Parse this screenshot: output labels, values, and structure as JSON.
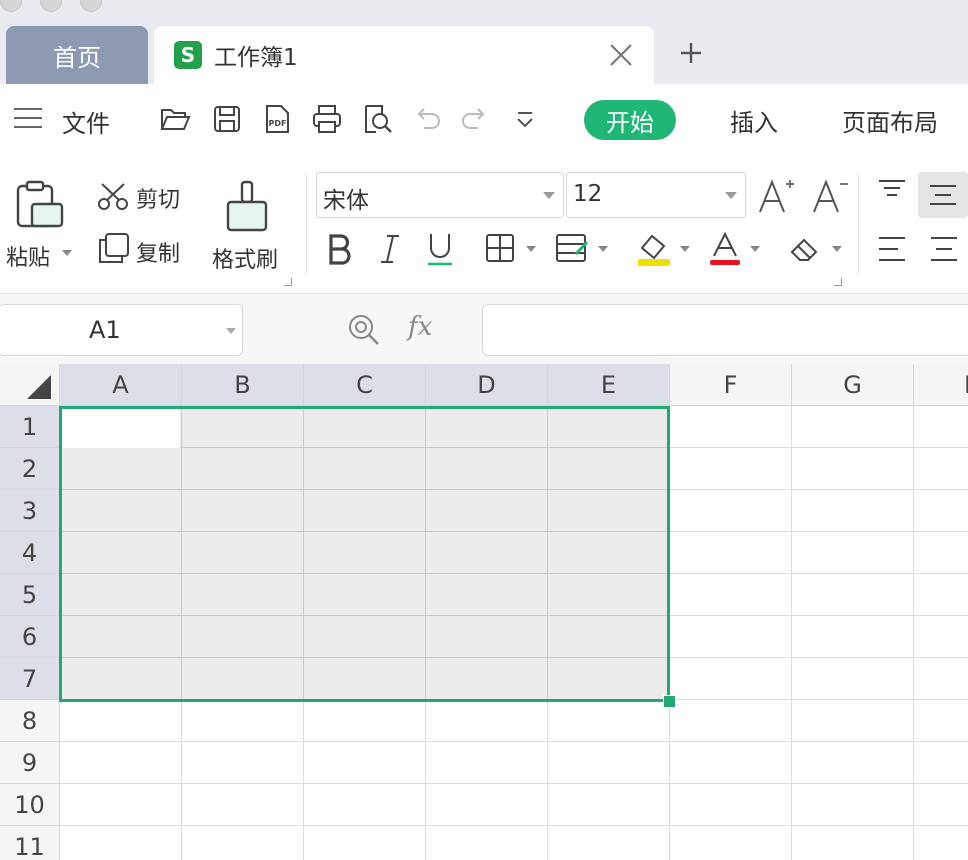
{
  "tabs": {
    "home_label": "首页",
    "doc_logo": "S",
    "doc_label": "工作簿1",
    "add_label": "+"
  },
  "menu": {
    "file_label": "文件",
    "tabs": [
      {
        "label": "开始",
        "active": true
      },
      {
        "label": "插入",
        "active": false
      },
      {
        "label": "页面布局",
        "active": false
      }
    ]
  },
  "ribbon": {
    "paste_label": "粘贴",
    "cut_label": "剪切",
    "copy_label": "复制",
    "format_painter_label": "格式刷",
    "font_name": "宋体",
    "font_size": "12"
  },
  "formula_bar": {
    "name_box_value": "A1",
    "fx_label": "fx",
    "formula_value": ""
  },
  "grid": {
    "columns": [
      "A",
      "B",
      "C",
      "D",
      "E",
      "F",
      "G",
      "H"
    ],
    "rows": [
      "1",
      "2",
      "3",
      "4",
      "5",
      "6",
      "7",
      "8",
      "9",
      "10",
      "11"
    ],
    "selection": "A1:E7"
  },
  "colors": {
    "accent": "#1fb676",
    "selection_border": "#24a772",
    "home_tab": "#8e99b2",
    "logo": "#23a14a"
  }
}
